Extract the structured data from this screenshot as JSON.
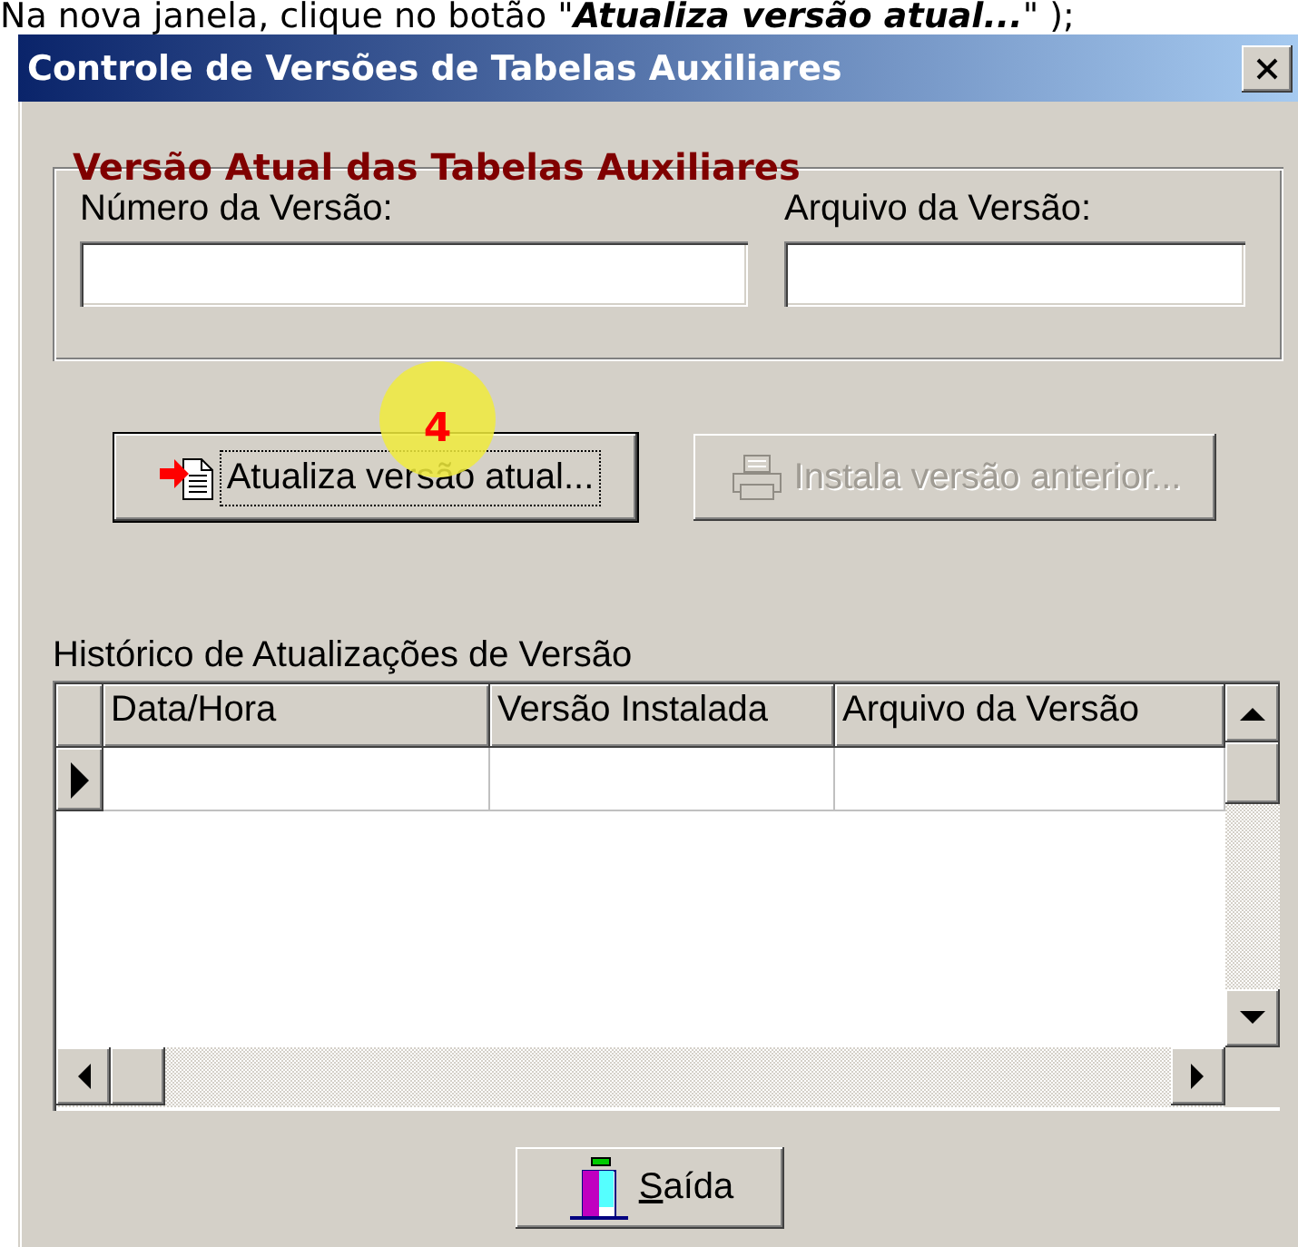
{
  "caption": "Na nova janela, clique no botão \"**Atualiza versão atual...**\" );",
  "window": {
    "title": "Controle de Versões de Tabelas Auxiliares"
  },
  "group": {
    "title": "Versão Atual das Tabelas Auxiliares",
    "fields": [
      {
        "label": "Número da Versão:"
      },
      {
        "label": "Arquivo da Versão:"
      }
    ]
  },
  "actions": [
    {
      "label": "Atualiza versão atual...",
      "kind": "update",
      "disabled": false,
      "focused": true
    },
    {
      "label": "Instala versão anterior...",
      "kind": "install",
      "disabled": true,
      "focused": false
    }
  ],
  "step_badge": "4",
  "history": {
    "title": "Histórico de Atualizações de Versão",
    "columns": [
      "Data/Hora",
      "Versão Instalada",
      "Arquivo da Versão"
    ],
    "rows": [
      {
        "selected": true
      }
    ]
  },
  "exit_button": {
    "label": "Saída",
    "mnemonic_underlined": true
  }
}
